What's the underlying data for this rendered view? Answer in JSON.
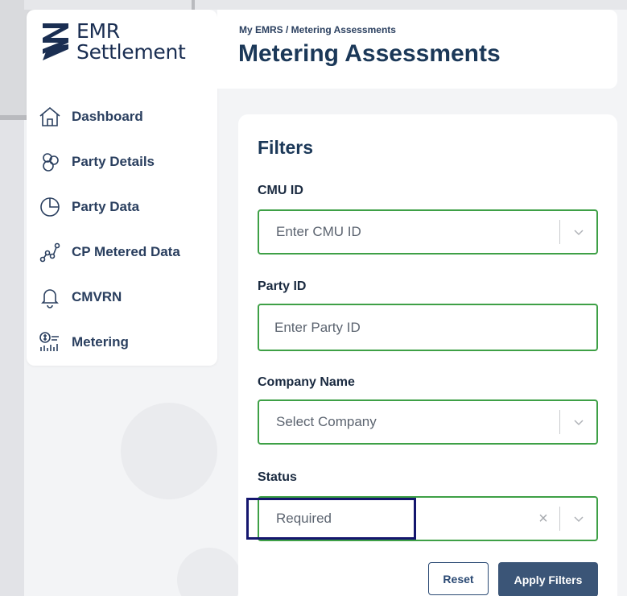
{
  "app": {
    "logo_line1": "EMR",
    "logo_line2": "Settlement"
  },
  "sidebar": {
    "items": [
      {
        "label": "Dashboard",
        "icon": "home-icon"
      },
      {
        "label": "Party Details",
        "icon": "people-icon"
      },
      {
        "label": "Party Data",
        "icon": "pie-chart-icon"
      },
      {
        "label": "CP Metered Data",
        "icon": "graph-nodes-icon"
      },
      {
        "label": "CMVRN",
        "icon": "bell-icon"
      },
      {
        "label": "Metering",
        "icon": "metering-icon"
      }
    ]
  },
  "header": {
    "breadcrumb": "My EMRS / Metering Assessments",
    "title": "Metering Assessments"
  },
  "filters": {
    "title": "Filters",
    "cmu_id": {
      "label": "CMU ID",
      "placeholder": "Enter CMU ID"
    },
    "party_id": {
      "label": "Party ID",
      "placeholder": "Enter Party ID"
    },
    "company_name": {
      "label": "Company Name",
      "placeholder": "Select Company"
    },
    "status": {
      "label": "Status",
      "value": "Required"
    },
    "reset_label": "Reset",
    "apply_label": "Apply Filters"
  },
  "colors": {
    "field_border": "#3ea046",
    "primary_button": "#3b5577",
    "highlight": "#14166e",
    "title_text": "#1b3858"
  }
}
